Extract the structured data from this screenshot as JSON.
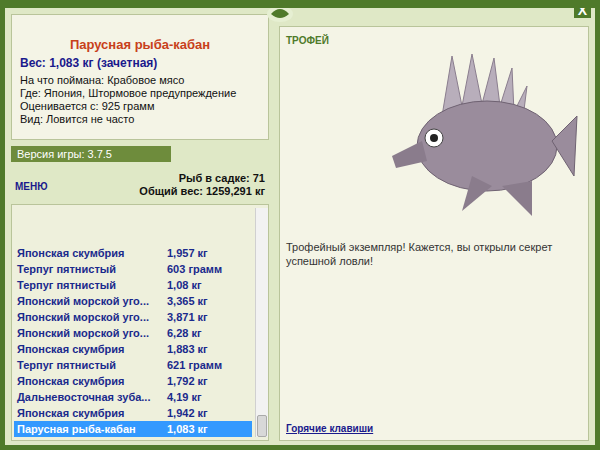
{
  "window": {
    "close": "X"
  },
  "info": {
    "title": "Парусная рыба-кабан",
    "weight": "Вес: 1,083 кг (зачетная)",
    "details": [
      "На что поймана: Крабовое мясо",
      "Где: Япония, Штормовое предупреждение",
      "Оценивается с: 925 грамм",
      "Вид: Ловится не часто"
    ]
  },
  "version": "Версия игры: 3.7.5",
  "menu": "МЕНЮ",
  "stats": [
    "Рыб в садке: 71",
    "Общий вес: 1259,291 кг"
  ],
  "catch_list": {
    "scroll_position": 1,
    "rows": [
      {
        "name": "Японская скумбрия",
        "weight": "1,957 кг",
        "selected": false
      },
      {
        "name": "Терпуг пятнистый",
        "weight": "603 грамм",
        "selected": false
      },
      {
        "name": "Терпуг пятнистый",
        "weight": "1,08 кг",
        "selected": false
      },
      {
        "name": "Японский морской уго...",
        "weight": "3,365 кг",
        "selected": false
      },
      {
        "name": "Японский морской уго...",
        "weight": "3,871 кг",
        "selected": false
      },
      {
        "name": "Японский морской уго...",
        "weight": "6,28 кг",
        "selected": false
      },
      {
        "name": "Японская скумбрия",
        "weight": "1,883 кг",
        "selected": false
      },
      {
        "name": "Терпуг пятнистый",
        "weight": "621 грамм",
        "selected": false
      },
      {
        "name": "Японская скумбрия",
        "weight": "1,792 кг",
        "selected": false
      },
      {
        "name": "Дальневосточная зуба...",
        "weight": "4,19 кг",
        "selected": false
      },
      {
        "name": "Японская скумбрия",
        "weight": "1,942 кг",
        "selected": false
      },
      {
        "name": "Парусная рыба-кабан",
        "weight": "1,083 кг",
        "selected": true
      }
    ]
  },
  "trophy": {
    "label": "ТРОФЕЙ",
    "description": "Трофейный экземпляр! Кажется, вы открыли секрет успешной ловли!",
    "hotkeys": "Горячие клавиши"
  }
}
